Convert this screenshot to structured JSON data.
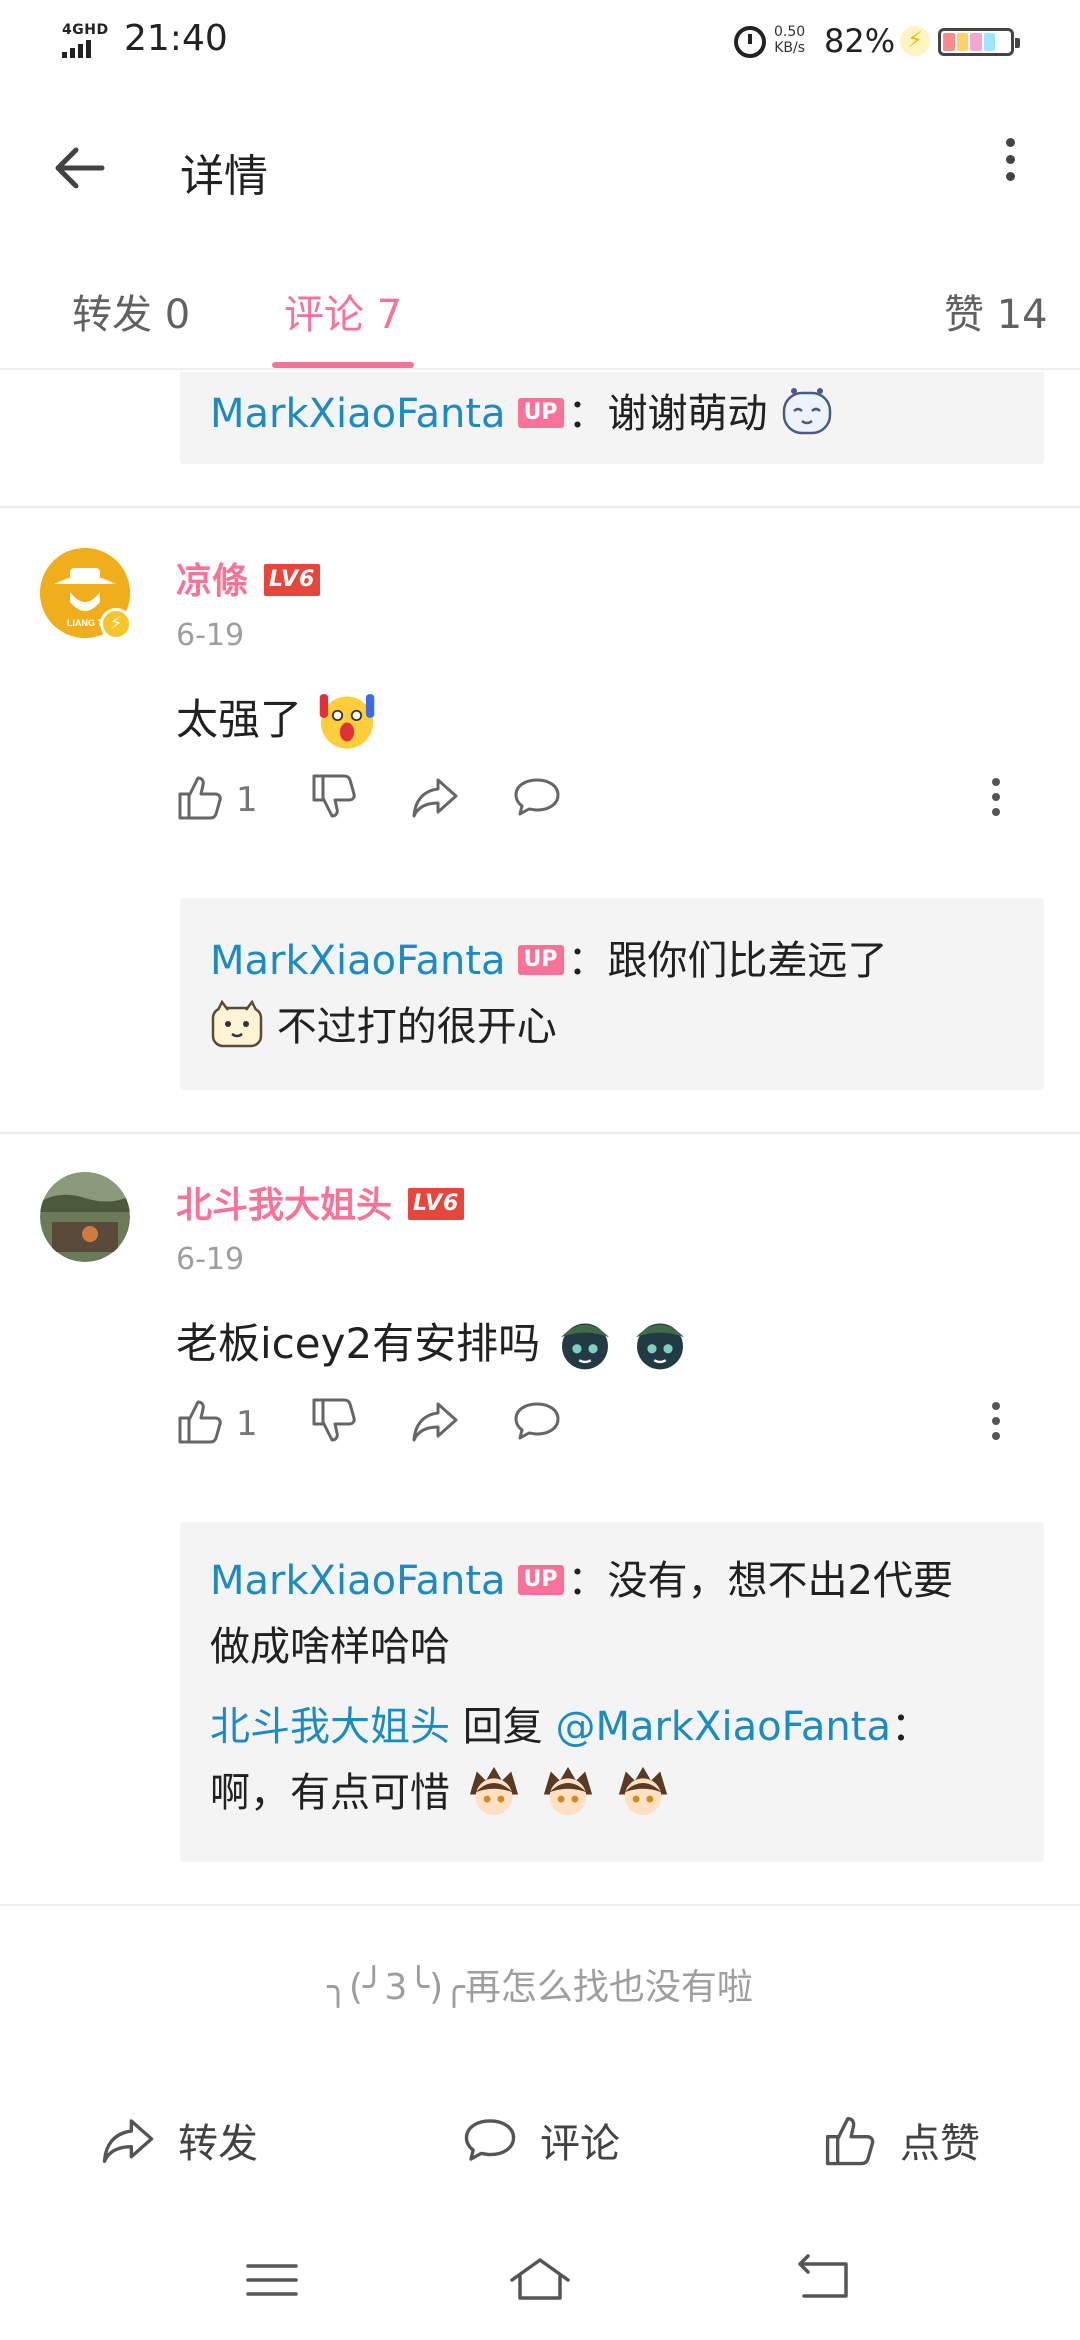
{
  "status_bar": {
    "network": "4GHD",
    "time": "21:40",
    "speed_value": "0.50",
    "speed_unit": "KB/s",
    "battery": "82%"
  },
  "header": {
    "title": "详情",
    "back_icon": "back-arrow-icon",
    "more_icon": "more-vertical-icon"
  },
  "tabs": [
    {
      "label": "转发 0"
    },
    {
      "label": "评论 7"
    },
    {
      "label": "赞 14"
    }
  ],
  "colors": {
    "accent": "#fb7299",
    "link": "#1b8bc4",
    "level_badge": "#e8463b"
  },
  "top_reply": {
    "author": "MarkXiaoFanta",
    "badge": "UP",
    "text": "：谢谢萌动"
  },
  "comments": [
    {
      "author": "凉條",
      "level": "LV6",
      "date": "6-19",
      "text": "太强了",
      "likes": "1",
      "replies": [
        {
          "author": "MarkXiaoFanta",
          "badge": "UP",
          "line1": "：跟你们比差远了",
          "line2": "不过打的很开心"
        }
      ]
    },
    {
      "author": "北斗我大姐头",
      "level": "LV6",
      "date": "6-19",
      "text": "老板icey2有安排吗",
      "likes": "1",
      "replies": [
        {
          "author": "MarkXiaoFanta",
          "badge": "UP",
          "line1": "：没有，想不出2代要",
          "line2": "做成啥样哈哈"
        },
        {
          "author": "北斗我大姐头",
          "reply_word": " 回复 ",
          "target": "@MarkXiaoFanta",
          "line1_suffix": "：",
          "line2": "啊，有点可惜"
        }
      ]
    }
  ],
  "footer_note": "╮(╯3╰)╭再怎么找也没有啦",
  "bottom_actions": [
    {
      "label": "转发",
      "icon": "share-icon"
    },
    {
      "label": "评论",
      "icon": "comment-icon"
    },
    {
      "label": "点赞",
      "icon": "like-icon"
    }
  ],
  "nav_bar": [
    "menu-icon",
    "home-icon",
    "back-icon"
  ]
}
